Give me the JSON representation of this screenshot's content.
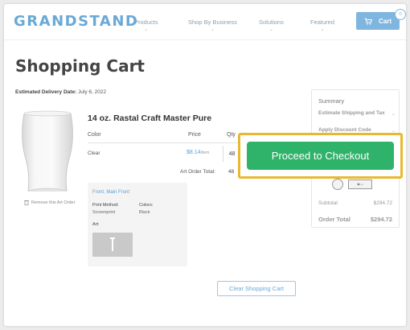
{
  "header": {
    "logo": "GRANDSTAND",
    "nav": [
      {
        "label": "Products"
      },
      {
        "label": "Shop By Business"
      },
      {
        "label": "Solutions"
      },
      {
        "label": "Featured"
      }
    ],
    "cart_label": "Cart",
    "cart_count": "0"
  },
  "page": {
    "title": "Shopping Cart",
    "delivery_label": "Estimated Delivery Date:",
    "delivery_date": "July 6, 2022"
  },
  "item": {
    "title": "14 oz. Rastal Craft Master Pure",
    "remove_label": "Remove this Art Order",
    "columns": {
      "color": "Color",
      "price": "Price",
      "qty": "Qty"
    },
    "color": "Clear",
    "price": "$8.14",
    "price_unit": "/item",
    "qty": "48",
    "art_total_label": "Art Order Total:",
    "art_total_qty": "48",
    "details": {
      "location": "Front, Main Front",
      "print_method_label": "Print Method:",
      "print_method": "Screenprint",
      "colors_label": "Colors:",
      "colors_value": "Black",
      "art_label": "Art:"
    }
  },
  "summary": {
    "title": "Summary",
    "shipping_label": "Estimate Shipping and Tax",
    "discount_label": "Apply Discount Code",
    "subtotal_label": "Subtotal",
    "subtotal_value": "$294.72",
    "total_label": "Order Total",
    "total_value": "$294.72"
  },
  "actions": {
    "checkout": "Proceed to Checkout",
    "clear_cart": "Clear Shopping Cart"
  },
  "colors": {
    "brand": "#6aa9d6",
    "checkout_green": "#2fb26a",
    "highlight": "#e8b92e"
  }
}
